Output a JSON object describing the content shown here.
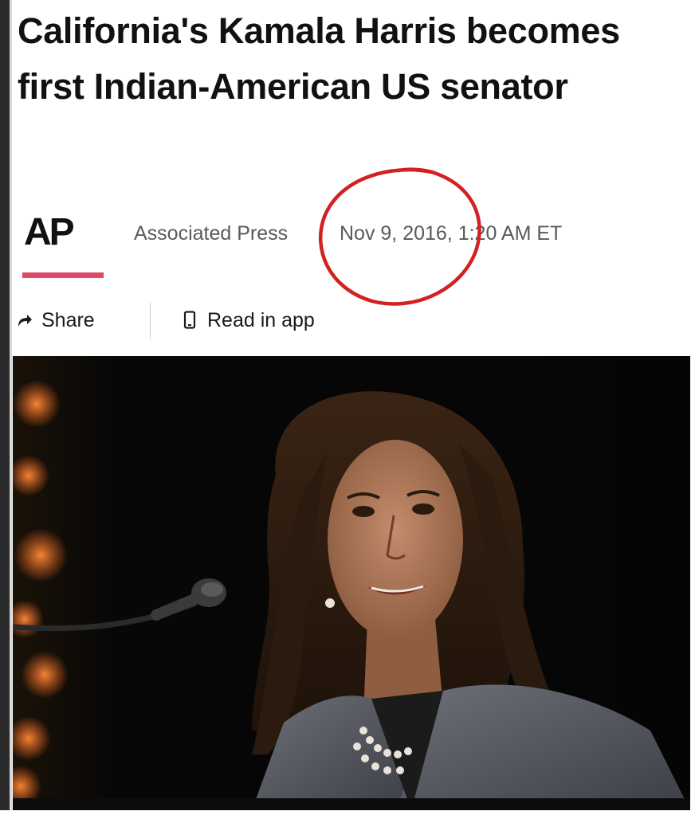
{
  "article": {
    "headline": "California's Kamala Harris becomes first Indian-American US senator",
    "publisher_logo": "AP",
    "publisher_name": "Associated Press",
    "timestamp": "Nov 9, 2016, 1:20 AM ET"
  },
  "actions": {
    "share_label": "Share",
    "share_icon": "share-arrow-icon",
    "read_in_app_label": "Read in app",
    "read_in_app_icon": "phone-icon"
  },
  "colors": {
    "accent_underline": "#e0486a",
    "annotation": "#d42020",
    "meta_text": "#5a5a5a"
  }
}
